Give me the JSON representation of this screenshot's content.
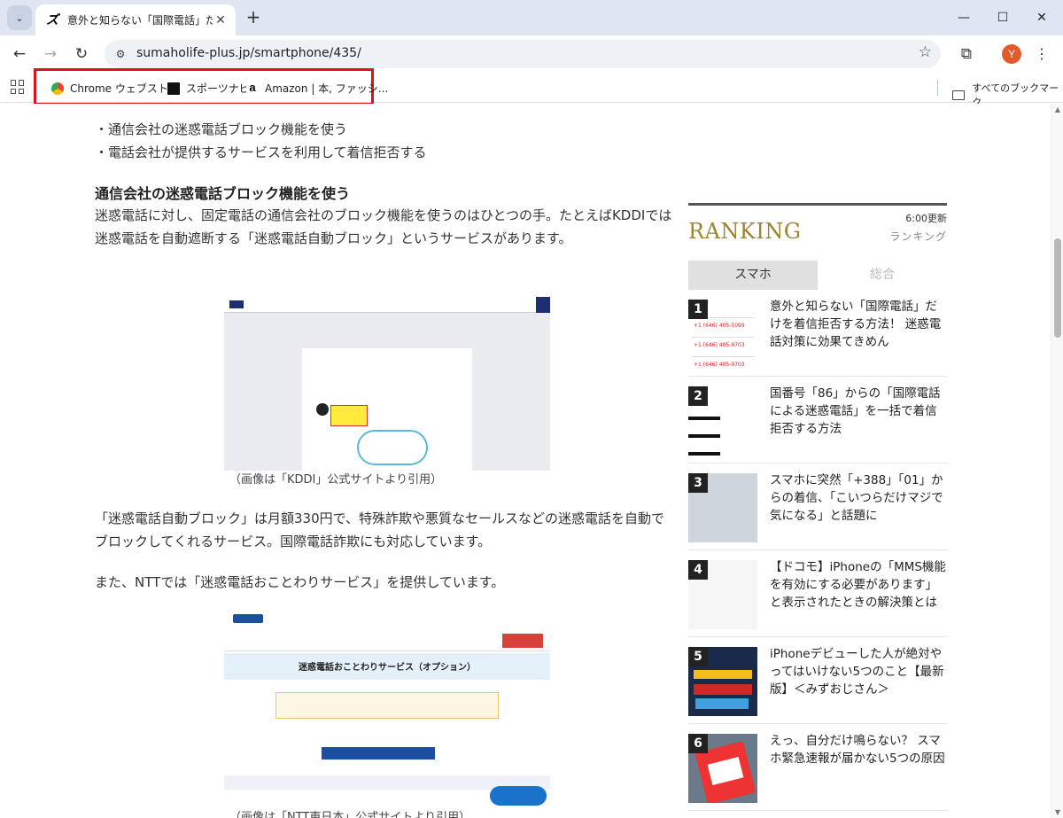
{
  "browser": {
    "tab_title": "意外と知らない「国際電話」だけを着",
    "tab_close": "✕",
    "new_tab": "+",
    "url": "sumaholife-plus.jp/smartphone/435/",
    "avatar_letter": "Y",
    "window": {
      "minimize": "—",
      "maximize": "☐",
      "close": "✕"
    }
  },
  "bookmarks": {
    "items": [
      {
        "label": "Chrome ウェブストア",
        "icon": "chrome-web-store-icon"
      },
      {
        "label": "スポーツナビ",
        "icon": "sportsnavi-icon"
      },
      {
        "label": "Amazon | 本, ファッシ...",
        "icon": "amazon-icon"
      }
    ],
    "all_bookmarks": "すべてのブックマーク",
    "highlight_color": "#d9141e"
  },
  "article": {
    "bullets": [
      "・通信会社の迷惑電話ブロック機能を使う",
      "・電話会社が提供するサービスを利用して着信拒否する"
    ],
    "heading": "通信会社の迷惑電話ブロック機能を使う",
    "para1": "迷惑電話に対し、固定電話の通信会社のブロック機能を使うのはひとつの手。たとえばKDDIでは迷惑電話を自動遮断する「迷惑電話自動ブロック」というサービスがあります。",
    "caption1": "（画像は「KDDI」公式サイトより引用）",
    "para2": "「迷惑電話自動ブロック」は月額330円で、特殊詐欺や悪質なセールスなどの迷惑電話を自動でブロックしてくれるサービス。国際電話詐欺にも対応しています。",
    "para3": "また、NTTでは「迷惑電話おことわりサービス」を提供しています。",
    "ntt_banner": "迷惑電話おことわりサービス（オプション）",
    "caption2": "（画像は「NTT東日本」公式サイトより引用）"
  },
  "ranking": {
    "updated": "6:00更新",
    "title": "RANKING",
    "subtitle": "ランキング",
    "title_color": "#9c8430",
    "tabs": [
      {
        "label": "スマホ",
        "active": true
      },
      {
        "label": "総合",
        "active": false
      }
    ],
    "items": [
      {
        "rank": "1",
        "title": "意外と知らない「国際電話」だけを着信拒否する方法！ 迷惑電話対策に効果てきめん"
      },
      {
        "rank": "2",
        "title": "国番号「86」からの「国際電話による迷惑電話」を一括で着信拒否する方法"
      },
      {
        "rank": "3",
        "title": "スマホに突然「+388」「01」からの着信、「こいつらだけマジで気になる」と話題に"
      },
      {
        "rank": "4",
        "title": "【ドコモ】iPhoneの「MMS機能を有効にする必要があります」と表示されたときの解決策とは"
      },
      {
        "rank": "5",
        "title": "iPhoneデビューした人が絶対やってはいけない5つのこと【最新版】＜みずおじさん＞"
      },
      {
        "rank": "6",
        "title": "えっ、自分だけ鳴らない？ スマホ緊急速報が届かない5つの原因"
      }
    ]
  }
}
